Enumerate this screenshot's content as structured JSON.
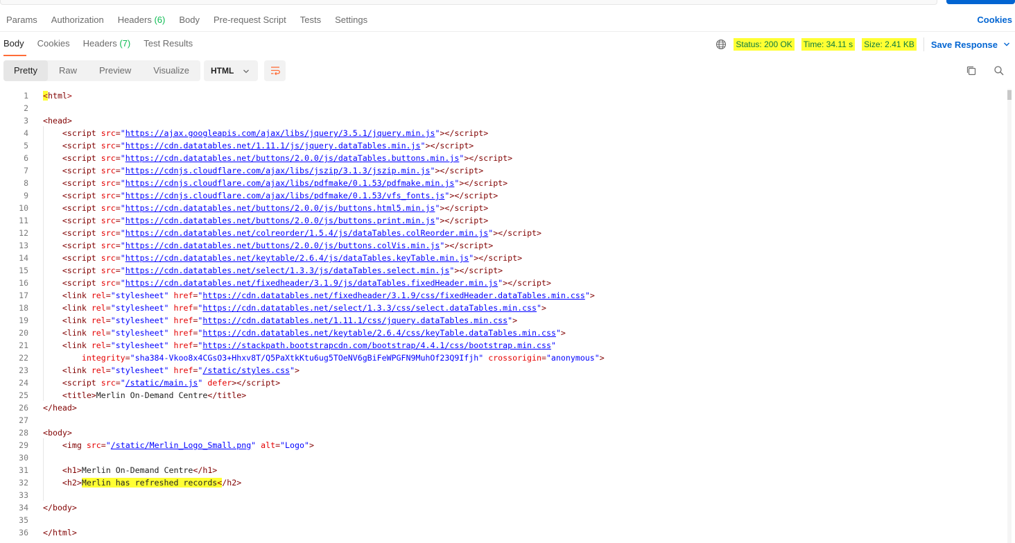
{
  "request_tabs": {
    "params": "Params",
    "authorization": "Authorization",
    "headers": "Headers",
    "headers_count": "(6)",
    "body": "Body",
    "pre_request": "Pre-request Script",
    "tests": "Tests",
    "settings": "Settings",
    "cookies": "Cookies"
  },
  "response_tabs": {
    "body": "Body",
    "cookies": "Cookies",
    "headers": "Headers",
    "headers_count": "(7)",
    "test_results": "Test Results"
  },
  "response_meta": {
    "status": "Status: 200 OK",
    "time": "Time: 34.11 s",
    "size": "Size: 2.41 KB",
    "save_response": "Save Response"
  },
  "toolbar": {
    "pretty": "Pretty",
    "raw": "Raw",
    "preview": "Preview",
    "visualize": "Visualize",
    "format": "HTML"
  },
  "colors": {
    "accent_orange": "#ff6c37",
    "link_blue": "#0265d2",
    "highlight_yellow": "#ffff33",
    "status_green": "#0c7a3e"
  },
  "code_lines": [
    {
      "n": "1",
      "html": "<span class=\"hl\">&lt;</span><span class=\"t\">html</span>&gt;"
    },
    {
      "n": "2",
      "html": ""
    },
    {
      "n": "3",
      "html": "<span class=\"t\">&lt;head&gt;</span>"
    },
    {
      "n": "4",
      "html": "    <span class=\"t\">&lt;script</span> <span class=\"a\">src</span>=<span class=\"v\">\"</span><span class=\"u\">https://ajax.googleapis.com/ajax/libs/jquery/3.5.1/jquery.min.js</span><span class=\"v\">\"</span><span class=\"t\">&gt;&lt;/script&gt;</span>"
    },
    {
      "n": "5",
      "html": "    <span class=\"t\">&lt;script</span> <span class=\"a\">src</span>=<span class=\"v\">\"</span><span class=\"u\">https://cdn.datatables.net/1.11.1/js/jquery.dataTables.min.js</span><span class=\"v\">\"</span><span class=\"t\">&gt;&lt;/script&gt;</span>"
    },
    {
      "n": "6",
      "html": "    <span class=\"t\">&lt;script</span> <span class=\"a\">src</span>=<span class=\"v\">\"</span><span class=\"u\">https://cdn.datatables.net/buttons/2.0.0/js/dataTables.buttons.min.js</span><span class=\"v\">\"</span><span class=\"t\">&gt;&lt;/script&gt;</span>"
    },
    {
      "n": "7",
      "html": "    <span class=\"t\">&lt;script</span> <span class=\"a\">src</span>=<span class=\"v\">\"</span><span class=\"u\">https://cdnjs.cloudflare.com/ajax/libs/jszip/3.1.3/jszip.min.js</span><span class=\"v\">\"</span><span class=\"t\">&gt;&lt;/script&gt;</span>"
    },
    {
      "n": "8",
      "html": "    <span class=\"t\">&lt;script</span> <span class=\"a\">src</span>=<span class=\"v\">\"</span><span class=\"u\">https://cdnjs.cloudflare.com/ajax/libs/pdfmake/0.1.53/pdfmake.min.js</span><span class=\"v\">\"</span><span class=\"t\">&gt;&lt;/script&gt;</span>"
    },
    {
      "n": "9",
      "html": "    <span class=\"t\">&lt;script</span> <span class=\"a\">src</span>=<span class=\"v\">\"</span><span class=\"u\">https://cdnjs.cloudflare.com/ajax/libs/pdfmake/0.1.53/vfs_fonts.js</span><span class=\"v\">\"</span><span class=\"t\">&gt;&lt;/script&gt;</span>"
    },
    {
      "n": "10",
      "html": "    <span class=\"t\">&lt;script</span> <span class=\"a\">src</span>=<span class=\"v\">\"</span><span class=\"u\">https://cdn.datatables.net/buttons/2.0.0/js/buttons.html5.min.js</span><span class=\"v\">\"</span><span class=\"t\">&gt;&lt;/script&gt;</span>"
    },
    {
      "n": "11",
      "html": "    <span class=\"t\">&lt;script</span> <span class=\"a\">src</span>=<span class=\"v\">\"</span><span class=\"u\">https://cdn.datatables.net/buttons/2.0.0/js/buttons.print.min.js</span><span class=\"v\">\"</span><span class=\"t\">&gt;&lt;/script&gt;</span>"
    },
    {
      "n": "12",
      "html": "    <span class=\"t\">&lt;script</span> <span class=\"a\">src</span>=<span class=\"v\">\"</span><span class=\"u\">https://cdn.datatables.net/colreorder/1.5.4/js/dataTables.colReorder.min.js</span><span class=\"v\">\"</span><span class=\"t\">&gt;&lt;/script&gt;</span>"
    },
    {
      "n": "13",
      "html": "    <span class=\"t\">&lt;script</span> <span class=\"a\">src</span>=<span class=\"v\">\"</span><span class=\"u\">https://cdn.datatables.net/buttons/2.0.0/js/buttons.colVis.min.js</span><span class=\"v\">\"</span><span class=\"t\">&gt;&lt;/script&gt;</span>"
    },
    {
      "n": "14",
      "html": "    <span class=\"t\">&lt;script</span> <span class=\"a\">src</span>=<span class=\"v\">\"</span><span class=\"u\">https://cdn.datatables.net/keytable/2.6.4/js/dataTables.keyTable.min.js</span><span class=\"v\">\"</span><span class=\"t\">&gt;&lt;/script&gt;</span>"
    },
    {
      "n": "15",
      "html": "    <span class=\"t\">&lt;script</span> <span class=\"a\">src</span>=<span class=\"v\">\"</span><span class=\"u\">https://cdn.datatables.net/select/1.3.3/js/dataTables.select.min.js</span><span class=\"v\">\"</span><span class=\"t\">&gt;&lt;/script&gt;</span>"
    },
    {
      "n": "16",
      "html": "    <span class=\"t\">&lt;script</span> <span class=\"a\">src</span>=<span class=\"v\">\"</span><span class=\"u\">https://cdn.datatables.net/fixedheader/3.1.9/js/dataTables.fixedHeader.min.js</span><span class=\"v\">\"</span><span class=\"t\">&gt;&lt;/script&gt;</span>"
    },
    {
      "n": "17",
      "html": "    <span class=\"t\">&lt;link</span> <span class=\"a\">rel</span>=<span class=\"v\">\"stylesheet\"</span> <span class=\"a\">href</span>=<span class=\"v\">\"</span><span class=\"u\">https://cdn.datatables.net/fixedheader/3.1.9/css/fixedHeader.dataTables.min.css</span><span class=\"v\">\"</span><span class=\"t\">&gt;</span>"
    },
    {
      "n": "18",
      "html": "    <span class=\"t\">&lt;link</span> <span class=\"a\">rel</span>=<span class=\"v\">\"stylesheet\"</span> <span class=\"a\">href</span>=<span class=\"v\">\"</span><span class=\"u\">https://cdn.datatables.net/select/1.3.3/css/select.dataTables.min.css</span><span class=\"v\">\"</span><span class=\"t\">&gt;</span>"
    },
    {
      "n": "19",
      "html": "    <span class=\"t\">&lt;link</span> <span class=\"a\">rel</span>=<span class=\"v\">\"stylesheet\"</span> <span class=\"a\">href</span>=<span class=\"v\">\"</span><span class=\"u\">https://cdn.datatables.net/1.11.1/css/jquery.dataTables.min.css</span><span class=\"v\">\"</span><span class=\"t\">&gt;</span>"
    },
    {
      "n": "20",
      "html": "    <span class=\"t\">&lt;link</span> <span class=\"a\">rel</span>=<span class=\"v\">\"stylesheet\"</span> <span class=\"a\">href</span>=<span class=\"v\">\"</span><span class=\"u\">https://cdn.datatables.net/keytable/2.6.4/css/keyTable.dataTables.min.css</span><span class=\"v\">\"</span><span class=\"t\">&gt;</span>"
    },
    {
      "n": "21",
      "html": "    <span class=\"t\">&lt;link</span> <span class=\"a\">rel</span>=<span class=\"v\">\"stylesheet\"</span> <span class=\"a\">href</span>=<span class=\"v\">\"</span><span class=\"u\">https://stackpath.bootstrapcdn.com/bootstrap/4.4.1/css/bootstrap.min.css</span><span class=\"v\">\"</span>"
    },
    {
      "n": "22",
      "html": "        <span class=\"a\">integrity</span>=<span class=\"v\">\"sha384-Vkoo8x4CGsO3+Hhxv8T/Q5PaXtkKtu6ug5TOeNV6gBiFeWPGFN9MuhOf23Q9Ifjh\"</span> <span class=\"a\">crossorigin</span>=<span class=\"v\">\"anonymous\"</span><span class=\"t\">&gt;</span>"
    },
    {
      "n": "23",
      "html": "    <span class=\"t\">&lt;link</span> <span class=\"a\">rel</span>=<span class=\"v\">\"stylesheet\"</span> <span class=\"a\">href</span>=<span class=\"v\">\"</span><span class=\"u\">/static/styles.css</span><span class=\"v\">\"</span><span class=\"t\">&gt;</span>"
    },
    {
      "n": "24",
      "html": "    <span class=\"t\">&lt;script</span> <span class=\"a\">src</span>=<span class=\"v\">\"</span><span class=\"u\">/static/main.js</span><span class=\"v\">\"</span> <span class=\"a\">defer</span><span class=\"t\">&gt;&lt;/script&gt;</span>"
    },
    {
      "n": "25",
      "html": "    <span class=\"t\">&lt;title&gt;</span><span class=\"x\">Merlin On-Demand Centre</span><span class=\"t\">&lt;/title&gt;</span>"
    },
    {
      "n": "26",
      "html": "<span class=\"t\">&lt;/head&gt;</span>"
    },
    {
      "n": "27",
      "html": ""
    },
    {
      "n": "28",
      "html": "<span class=\"t\">&lt;body&gt;</span>"
    },
    {
      "n": "29",
      "html": "    <span class=\"t\">&lt;img</span> <span class=\"a\">src</span>=<span class=\"v\">\"</span><span class=\"u\">/static/Merlin_Logo_Small.png</span><span class=\"v\">\"</span> <span class=\"a\">alt</span>=<span class=\"v\">\"Logo\"</span><span class=\"t\">&gt;</span>"
    },
    {
      "n": "30",
      "html": ""
    },
    {
      "n": "31",
      "html": "    <span class=\"t\">&lt;h1&gt;</span><span class=\"x\">Merlin On-Demand Centre</span><span class=\"t\">&lt;/h1&gt;</span>"
    },
    {
      "n": "32",
      "html": "    <span class=\"t\">&lt;h2&gt;</span><span class=\"x hl\">Merlin has refreshed records</span><span class=\"t\"><span class=\"hl\">&lt;</span>/h2&gt;</span>"
    },
    {
      "n": "33",
      "html": ""
    },
    {
      "n": "34",
      "html": "<span class=\"t\">&lt;/body&gt;</span>"
    },
    {
      "n": "35",
      "html": ""
    },
    {
      "n": "36",
      "html": "<span class=\"t\">&lt;/html&gt;</span>"
    }
  ]
}
